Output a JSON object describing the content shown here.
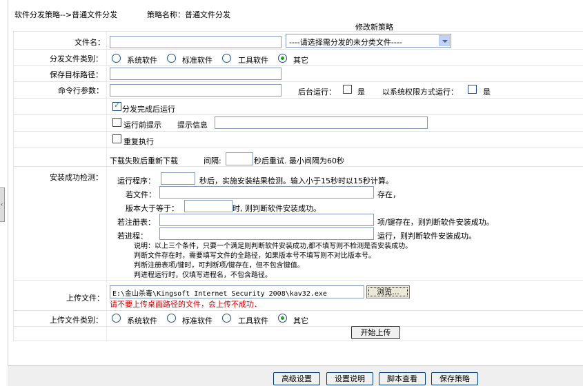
{
  "header": {
    "breadcrumb": "软件分发策略-->普通文件分发",
    "policy_name": "策略名称：普通文件分发",
    "section_title": "修改新策略"
  },
  "file_name": {
    "label": "文件名：",
    "value": "",
    "select_value": "----请选择需分发的未分类文件----"
  },
  "category": {
    "label": "分发文件类别：",
    "options": [
      "系统软件",
      "标准软件",
      "工具软件",
      "其它"
    ],
    "selected": "其它"
  },
  "save_path": {
    "label": "保存目标路径：",
    "value": ""
  },
  "cmd_params": {
    "label": "命令行参数：",
    "value": "",
    "background_label": "后台运行：",
    "background_value": "是",
    "sysperm_label": "以系统权限方式运行：",
    "sysperm_value": "是"
  },
  "run_after": {
    "label": "分发完成后运行",
    "checked": true
  },
  "prompt": {
    "label": "运行前提示",
    "info_label": "提示信息",
    "value": ""
  },
  "repeat": {
    "label": "重复执行",
    "checked": false
  },
  "retry": {
    "text1": "下载失败后重新下载",
    "text2": "间隔:",
    "value": "",
    "text3": "秒后重试.  最小间隔为60秒"
  },
  "install_check": {
    "label": "安装成功检测：",
    "run_label": "运行程序：",
    "run_suffix": "秒后，实施安装结果检测。输入小于15秒时以15秒计算。",
    "file_label": "若文件：",
    "file_suffix": "存在，",
    "version_label": "版本大于等于：",
    "version_suffix": "时, 则判断软件安装成功。",
    "reg_label": "若注册表：",
    "reg_suffix": "项/键存在，则判断软件安装成功。",
    "proc_label": "若进程：",
    "proc_suffix": "运行，则判断软件安装成功。",
    "notes": [
      "说明：以上三个条件，只要一个满足则判断软件安装成功,都不填写则不检测是否安装成功。",
      "判断文件存在时，需要填写文件的全路径，如果版本号不填写则不对比版本号。",
      "判断注册表项/键时，可判断项/键存在，但不包含键值。",
      "判进程运行时，仅填写进程名，不包含路径。"
    ]
  },
  "upload": {
    "label": "上传文件：",
    "value": "E:\\金山杀毒\\Kingsoft Internet Security 2008\\kav32.exe",
    "browse": "浏览...",
    "warning": "请不要上传桌面路径的文件，会上传不成功．",
    "type_label": "上传文件类别：",
    "type_options": [
      "系统软件",
      "标准软件",
      "工具软件",
      "其它"
    ],
    "type_selected": "其它",
    "start_button": "开始上传"
  },
  "bottom_buttons": {
    "advanced": "高级设置",
    "help": "设置说明",
    "script": "脚本查看",
    "save": "保存策略"
  },
  "colors": {
    "warning": "#cc0000",
    "checked": "#21a121",
    "input_border": "#7f9db9"
  }
}
